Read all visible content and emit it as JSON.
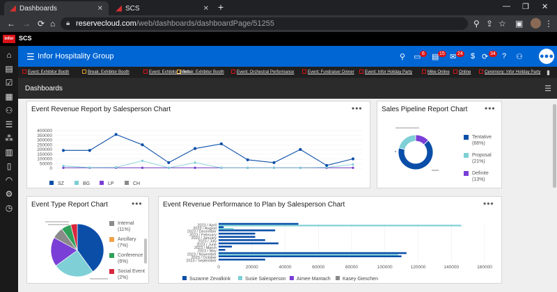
{
  "browser": {
    "tabs": [
      {
        "label": "Dashboards"
      },
      {
        "label": "SCS"
      }
    ],
    "url_host": "reservecloud.com",
    "url_path": "/web/dashboards/dashboardPage/51255"
  },
  "scs": {
    "logo": "infor",
    "label": "SCS"
  },
  "app": {
    "title": "Infor Hospitality Group",
    "badges": {
      "messages": "6",
      "tasks": "15",
      "mail": "24",
      "alerts": "34"
    }
  },
  "events": [
    {
      "label": "Event: Exhibitor Booth",
      "kind": "event"
    },
    {
      "label": "Break: Exhibitor Booth",
      "kind": "break"
    },
    {
      "label": "Event: Exhibitor Booth",
      "kind": "event"
    },
    {
      "label": "Break: Exhibitor Booth",
      "kind": "break"
    },
    {
      "label": "Event: Orchestral Performance",
      "kind": "event"
    },
    {
      "label": "Event: Fundraiser Dinner",
      "kind": "event"
    },
    {
      "label": "Event: Infor Holiday Party",
      "kind": "event"
    },
    {
      "label": "Mike Online",
      "kind": "user"
    },
    {
      "label": "Online",
      "kind": "user"
    },
    {
      "label": "Ceremony: Infor Holiday Party",
      "kind": "event"
    }
  ],
  "dashboard": {
    "title": "Dashboards"
  },
  "colors": {
    "SZ": "#0a4ea8",
    "BG": "#7ecfd6",
    "LP": "#7a3fd6",
    "CH": "#8a8a8a",
    "green": "#2fa15a",
    "orange": "#f2a248",
    "red": "#d9263c"
  },
  "chart_data": [
    {
      "type": "line",
      "title": "Event Revenue Report by Salesperson Chart",
      "ylim": [
        0,
        400000
      ],
      "yticks": [
        "400000",
        "350000",
        "300000",
        "250000",
        "200000",
        "150000",
        "100000",
        "50000",
        "0"
      ],
      "legend": [
        "SZ",
        "BG",
        "LP",
        "CH"
      ],
      "series": [
        {
          "name": "SZ",
          "values": [
            190000,
            190000,
            360000,
            250000,
            60000,
            210000,
            260000,
            90000,
            60000,
            200000,
            30000,
            100000
          ]
        },
        {
          "name": "BG",
          "values": [
            25000,
            8000,
            10000,
            80000,
            5000,
            60000,
            5000,
            5000,
            5000,
            5000,
            10000,
            40000
          ]
        },
        {
          "name": "LP",
          "values": [
            5000,
            5000,
            5000,
            5000,
            5000,
            5000,
            5000,
            5000,
            5000,
            5000,
            5000,
            5000
          ]
        },
        {
          "name": "CH",
          "values": [
            5000,
            5000,
            5000,
            5000,
            5000,
            5000,
            5000,
            5000,
            5000,
            5000,
            5000,
            5000
          ]
        }
      ]
    },
    {
      "type": "pie",
      "title": "Sales Pipeline Report Chart",
      "donut": true,
      "slices": [
        {
          "label": "Tentative",
          "pct_label": "(66%)",
          "value": 66
        },
        {
          "label": "Proposal",
          "pct_label": "(21%)",
          "value": 21
        },
        {
          "label": "Definite",
          "pct_label": "(13%)",
          "value": 13
        }
      ]
    },
    {
      "type": "pie",
      "title": "Event Type Report Chart",
      "slices": [
        {
          "label": "Internal",
          "pct_label": "(11%)",
          "value": 11
        },
        {
          "label": "Ancillary",
          "pct_label": "(7%)",
          "value": 7
        },
        {
          "label": "Conference",
          "pct_label": "(6%)",
          "value": 6
        },
        {
          "label": "Social Event",
          "pct_label": "(2%)",
          "value": 2
        }
      ],
      "pie_values": [
        40,
        25,
        18,
        7,
        6,
        4
      ]
    },
    {
      "type": "bar",
      "title": "Event Revenue Performance to Plan by Salesperson Chart",
      "orientation": "horizontal",
      "categories": [
        "2023 / April",
        "2023 / August",
        "2023 / December",
        "2023 / February",
        "2023 / January",
        "2023 / July",
        "2023 / June",
        "2023 / March",
        "2023 / May",
        "2023 / November",
        "2023 / October",
        "2023 / September"
      ],
      "xlim": [
        0,
        160000
      ],
      "xticks": [
        "0",
        "20000",
        "40000",
        "60000",
        "80000",
        "100000",
        "120000",
        "140000",
        "160000"
      ],
      "series": [
        {
          "name": "Suzanne Zevalkink",
          "values": [
            48000,
            3000,
            34000,
            22000,
            22000,
            28000,
            36000,
            8000,
            4000,
            113000,
            110000,
            28000
          ]
        },
        {
          "name": "Susie Salesperson",
          "values": [
            146000,
            9000,
            0,
            0,
            0,
            0,
            0,
            0,
            0,
            108000,
            0,
            0
          ]
        },
        {
          "name": "Aimee Mantach",
          "values": [
            0,
            0,
            0,
            0,
            0,
            0,
            0,
            0,
            0,
            0,
            0,
            0
          ]
        },
        {
          "name": "Kasey Gieschen",
          "values": [
            0,
            0,
            0,
            0,
            0,
            0,
            0,
            0,
            0,
            0,
            0,
            0
          ]
        }
      ]
    }
  ]
}
